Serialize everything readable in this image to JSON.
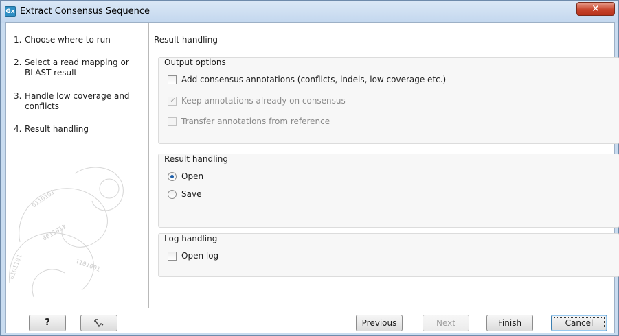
{
  "window": {
    "app_icon_text": "Gx",
    "title": "Extract Consensus Sequence",
    "close_glyph": "✕"
  },
  "steps": [
    {
      "num": "1.",
      "label": "Choose where to run"
    },
    {
      "num": "2.",
      "label": "Select a read mapping or BLAST result"
    },
    {
      "num": "3.",
      "label": "Handle low coverage and conflicts"
    },
    {
      "num": "4.",
      "label": "Result handling"
    }
  ],
  "content": {
    "heading": "Result handling",
    "output_options": {
      "title": "Output options",
      "items": [
        {
          "label": "Add consensus annotations (conflicts, indels, low coverage etc.)",
          "checked": false,
          "enabled": true
        },
        {
          "label": "Keep annotations already on consensus",
          "checked": true,
          "enabled": false
        },
        {
          "label": "Transfer annotations from reference",
          "checked": false,
          "enabled": false
        }
      ]
    },
    "result_handling": {
      "title": "Result handling",
      "options": [
        {
          "label": "Open",
          "selected": true
        },
        {
          "label": "Save",
          "selected": false
        }
      ]
    },
    "log_handling": {
      "title": "Log handling",
      "items": [
        {
          "label": "Open log",
          "checked": false
        }
      ]
    }
  },
  "buttons": {
    "help": "?",
    "reset_icon": "reset-arrow-icon",
    "previous": "Previous",
    "next": "Next",
    "finish": "Finish",
    "cancel": "Cancel"
  },
  "colors": {
    "window_frame": "#c9dcf0",
    "close_button": "#c7442b",
    "radio_selected": "#1d5ea8"
  }
}
